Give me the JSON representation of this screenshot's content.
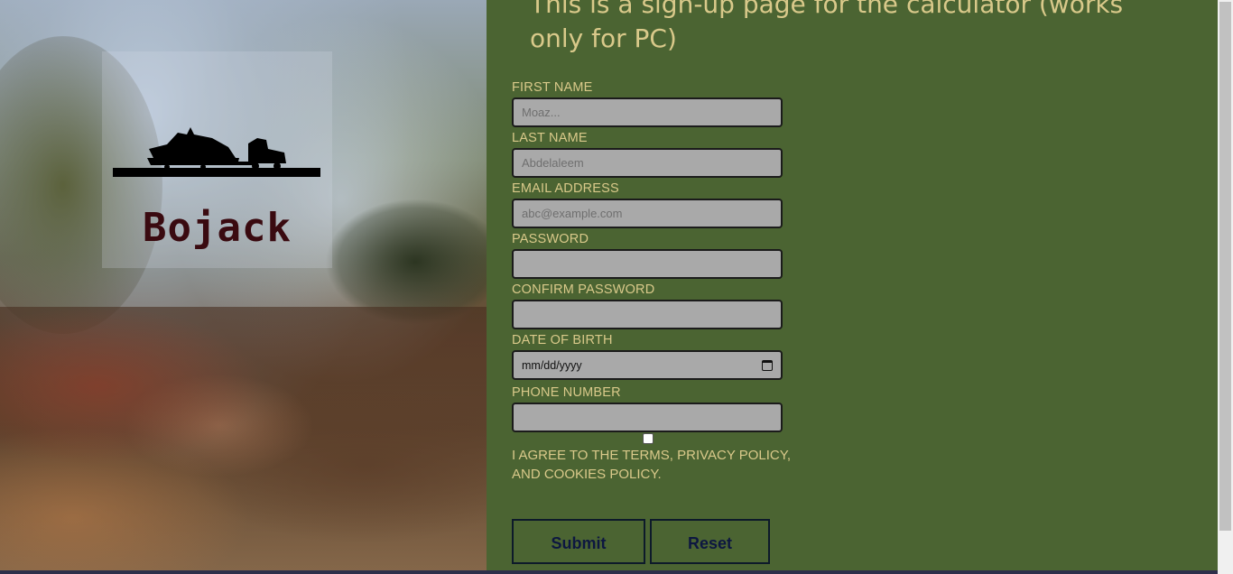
{
  "brand": {
    "name": "Bojack",
    "logo_icon": "truck-boat-silhouette-icon"
  },
  "heading": "This is a sign-up page for the calculator (works only for PC)",
  "form": {
    "first_name": {
      "label": "FIRST NAME",
      "placeholder": "Moaz..."
    },
    "last_name": {
      "label": "LAST NAME",
      "placeholder": "Abdelaleem"
    },
    "email": {
      "label": "EMAIL ADDRESS",
      "placeholder": "abc@example.com"
    },
    "password": {
      "label": "PASSWORD",
      "placeholder": ""
    },
    "confirm_password": {
      "label": "CONFIRM PASSWORD",
      "placeholder": ""
    },
    "dob": {
      "label": "DATE OF BIRTH",
      "value": "mm/dd/yyyy",
      "icon": "calendar-icon"
    },
    "phone": {
      "label": "PHONE NUMBER",
      "placeholder": ""
    },
    "agree_text": "I AGREE TO THE TERMS, PRIVACY POLICY, AND COOKIES POLICY.",
    "submit_label": "Submit",
    "reset_label": "Reset"
  },
  "colors": {
    "panel_bg": "#4b6432",
    "label_text": "#d9c98a",
    "input_bg": "#a9a9a9",
    "brand_text": "#3a0a10",
    "button_text": "#0d1740"
  }
}
